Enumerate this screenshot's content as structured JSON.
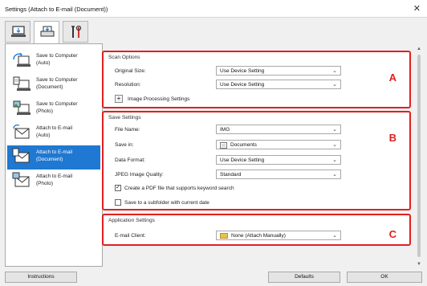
{
  "window": {
    "title": "Settings (Attach to E-mail (Document))",
    "close_glyph": "✕"
  },
  "tabs": [
    {
      "icon": "computer-scan-icon"
    },
    {
      "icon": "scanner-icon"
    },
    {
      "icon": "tools-icon"
    }
  ],
  "sidebar": {
    "items": [
      {
        "label": "Save to Computer\n(Auto)",
        "icon": "save-auto-icon"
      },
      {
        "label": "Save to Computer\n(Document)",
        "icon": "save-document-icon"
      },
      {
        "label": "Save to Computer\n(Photo)",
        "icon": "save-photo-icon"
      },
      {
        "label": "Attach to E-mail\n(Auto)",
        "icon": "email-auto-icon"
      },
      {
        "label": "Attach to E-mail\n(Document)",
        "icon": "email-document-icon"
      },
      {
        "label": "Attach to E-mail\n(Photo)",
        "icon": "email-photo-icon"
      }
    ],
    "selected_index": 4
  },
  "scan_options": {
    "title": "Scan Options",
    "letter": "A",
    "original_size_label": "Original Size:",
    "original_size_value": "Use Device Setting",
    "resolution_label": "Resolution:",
    "resolution_value": "Use Device Setting",
    "image_processing_label": "Image Processing Settings",
    "expand_glyph": "+"
  },
  "save_settings": {
    "title": "Save Settings",
    "letter": "B",
    "file_name_label": "File Name:",
    "file_name_value": "IMG",
    "save_in_label": "Save in:",
    "save_in_value": "Documents",
    "data_format_label": "Data Format:",
    "data_format_value": "Use Device Setting",
    "jpeg_quality_label": "JPEG Image Quality:",
    "jpeg_quality_value": "Standard",
    "pdf_keyword_label": "Create a PDF file that supports keyword search",
    "pdf_keyword_checked": true,
    "subfolder_label": "Save to a subfolder with current date",
    "subfolder_checked": false,
    "check_glyph": "✓"
  },
  "application_settings": {
    "title": "Application Settings",
    "letter": "C",
    "email_client_label": "E-mail Client:",
    "email_client_value": "None (Attach Manually)"
  },
  "dropdown_arrow": "⌄",
  "buttons": {
    "instructions": "Instructions",
    "defaults": "Defaults",
    "ok": "OK"
  },
  "colors": {
    "highlight_red": "#e02020",
    "selection_blue": "#1f78d1"
  }
}
